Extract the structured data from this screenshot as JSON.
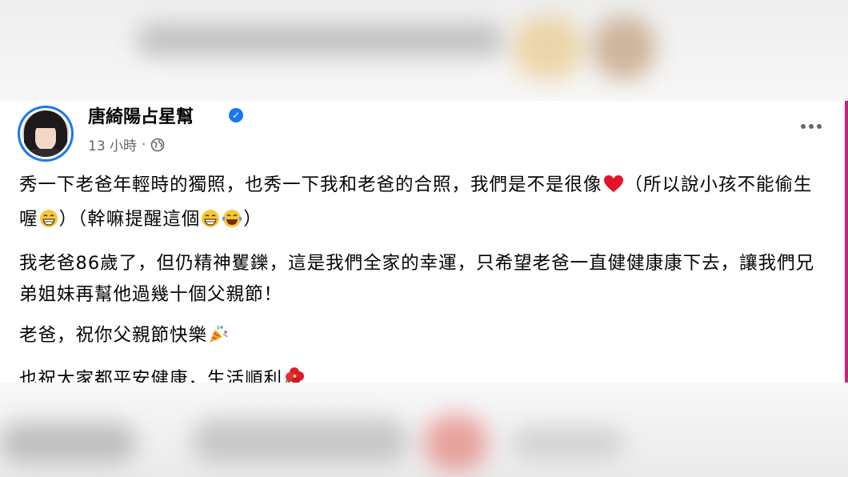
{
  "post": {
    "page_name": "唐綺陽占星幫",
    "time": "13 小時",
    "separator": "·",
    "paragraph1_part1": "秀一下老爸年輕時的獨照，也秀一下我和老爸的合照，我們是不是很像",
    "paragraph1_part2": "（所以說小孩不能偷生喔",
    "paragraph1_part3": "）（幹嘛提醒這個",
    "paragraph1_part4": "）",
    "paragraph2": "我老爸86歲了，但仍精神矍鑠，這是我們全家的幸運，只希望老爸一直健健康康下去，讓我們兄弟姐妹再幫他過幾十個父親節！",
    "paragraph3": "老爸，祝你父親節快樂",
    "paragraph4": "也祝大家都平安健康，生活順利"
  },
  "icons": {
    "verified": "verified-badge-icon",
    "audience": "globe-icon",
    "more": "more-options-icon",
    "heart": "red-heart-emoji",
    "grin": "grinning-emoji",
    "laugh": "tears-of-joy-emoji",
    "party": "party-popper-emoji",
    "flower": "hibiscus-emoji"
  },
  "colors": {
    "brand_blue": "#1877f2",
    "text": "#050505",
    "secondary_text": "#65676b",
    "side_accent": "#c0277a"
  }
}
